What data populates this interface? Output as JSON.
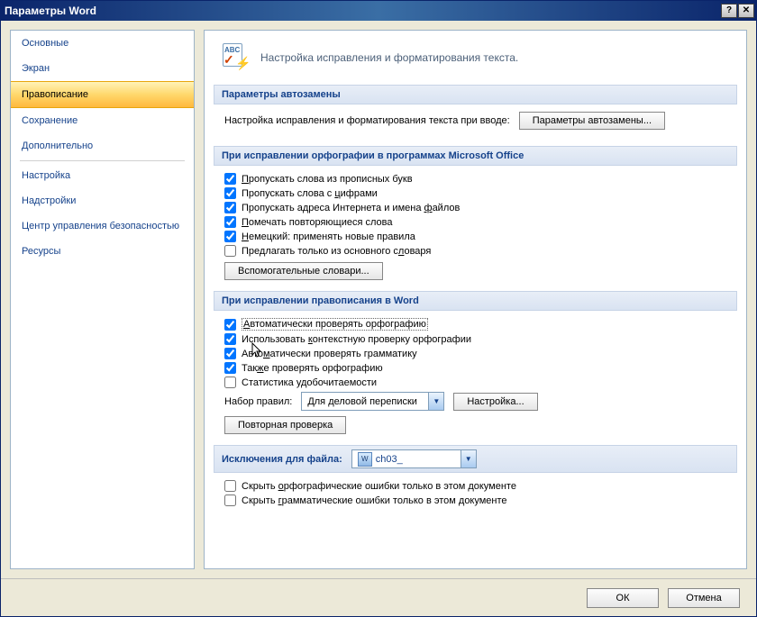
{
  "window": {
    "title": "Параметры Word"
  },
  "nav": {
    "items": [
      {
        "label": "Основные"
      },
      {
        "label": "Экран"
      },
      {
        "label": "Правописание",
        "active": true
      },
      {
        "label": "Сохранение"
      },
      {
        "label": "Дополнительно"
      },
      {
        "label": "Настройка"
      },
      {
        "label": "Надстройки"
      },
      {
        "label": "Центр управления безопасностью"
      },
      {
        "label": "Ресурсы"
      }
    ]
  },
  "header": {
    "icon_abc": "ABC",
    "text": "Настройка исправления и форматирования текста."
  },
  "sections": {
    "autocorrect": {
      "title": "Параметры автозамены",
      "desc": "Настройка исправления и форматирования текста при вводе:",
      "button": "Параметры автозамены..."
    },
    "office_spell": {
      "title": "При исправлении орфографии в программах Microsoft Office",
      "checks": [
        {
          "label_u": "П",
          "label_rest": "ропускать слова из прописных букв",
          "checked": true
        },
        {
          "label_pre": "Пропускать слова с ",
          "label_u": "ц",
          "label_rest": "ифрами",
          "checked": true
        },
        {
          "label_pre": "Пропускать адреса Интернета и имена ",
          "label_u": "ф",
          "label_rest": "айлов",
          "checked": true
        },
        {
          "label_u": "П",
          "label_rest": "омечать повторяющиеся слова",
          "checked": true
        },
        {
          "label_u": "Н",
          "label_rest": "емецкий: применять новые правила",
          "checked": true
        },
        {
          "label_pre": "Предлагать только из основного с",
          "label_u": "л",
          "label_rest": "оваря",
          "checked": false
        }
      ],
      "dict_button": "Вспомогательные словари..."
    },
    "word_spell": {
      "title": "При исправлении правописания в Word",
      "checks": [
        {
          "label_u": "А",
          "label_rest": "втоматически проверять орфографию",
          "checked": true
        },
        {
          "label_pre": "Использовать ",
          "label_u": "к",
          "label_rest": "онтекстную проверку орфографии",
          "checked": true
        },
        {
          "label_pre": "Авто",
          "label_u": "м",
          "label_rest": "атически проверять грамматику",
          "checked": true
        },
        {
          "label_pre": "Так",
          "label_u": "ж",
          "label_rest": "е проверять орфографию",
          "checked": true
        },
        {
          "label_pre": "Статистика у",
          "label_u": "д",
          "label_rest": "обочитаемости",
          "checked": false
        }
      ],
      "rules_label": "Набор правил:",
      "rules_value": "Для деловой переписки",
      "settings_button": "Настройка...",
      "recheck_button": "Повторная проверка"
    },
    "exceptions": {
      "title": "Исключения для файла:",
      "file_value": "ch03_",
      "checks": [
        {
          "label_pre": "Скрыть ",
          "label_u": "о",
          "label_rest": "рфографические ошибки только в этом документе",
          "checked": false
        },
        {
          "label_pre": "Скрыть ",
          "label_u": "г",
          "label_rest": "рамматические ошибки только в этом документе",
          "checked": false
        }
      ]
    }
  },
  "footer": {
    "ok": "ОК",
    "cancel": "Отмена"
  }
}
